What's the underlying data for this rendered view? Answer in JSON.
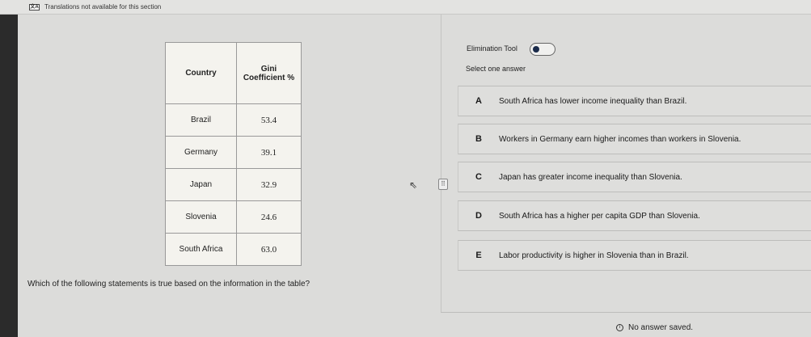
{
  "topbar": {
    "translation_notice": "Translations not available for this section"
  },
  "table": {
    "headers": {
      "country": "Country",
      "gini": "Gini Coefficient %"
    },
    "rows": [
      {
        "country": "Brazil",
        "value": "53.4"
      },
      {
        "country": "Germany",
        "value": "39.1"
      },
      {
        "country": "Japan",
        "value": "32.9"
      },
      {
        "country": "Slovenia",
        "value": "24.6"
      },
      {
        "country": "South Africa",
        "value": "63.0"
      }
    ]
  },
  "question": "Which of the following statements is true based on the information in the table?",
  "elimination_tool": {
    "label": "Elimination Tool"
  },
  "select_prompt": "Select one answer",
  "choices": [
    {
      "letter": "A",
      "text": "South Africa has lower income inequality than Brazil."
    },
    {
      "letter": "B",
      "text": "Workers in Germany earn higher incomes than workers in Slovenia."
    },
    {
      "letter": "C",
      "text": "Japan has greater income inequality than Slovenia."
    },
    {
      "letter": "D",
      "text": "South Africa has a higher per capita GDP than Slovenia."
    },
    {
      "letter": "E",
      "text": "Labor productivity is higher in Slovenia than in Brazil."
    }
  ],
  "status": {
    "text": "No answer saved."
  }
}
